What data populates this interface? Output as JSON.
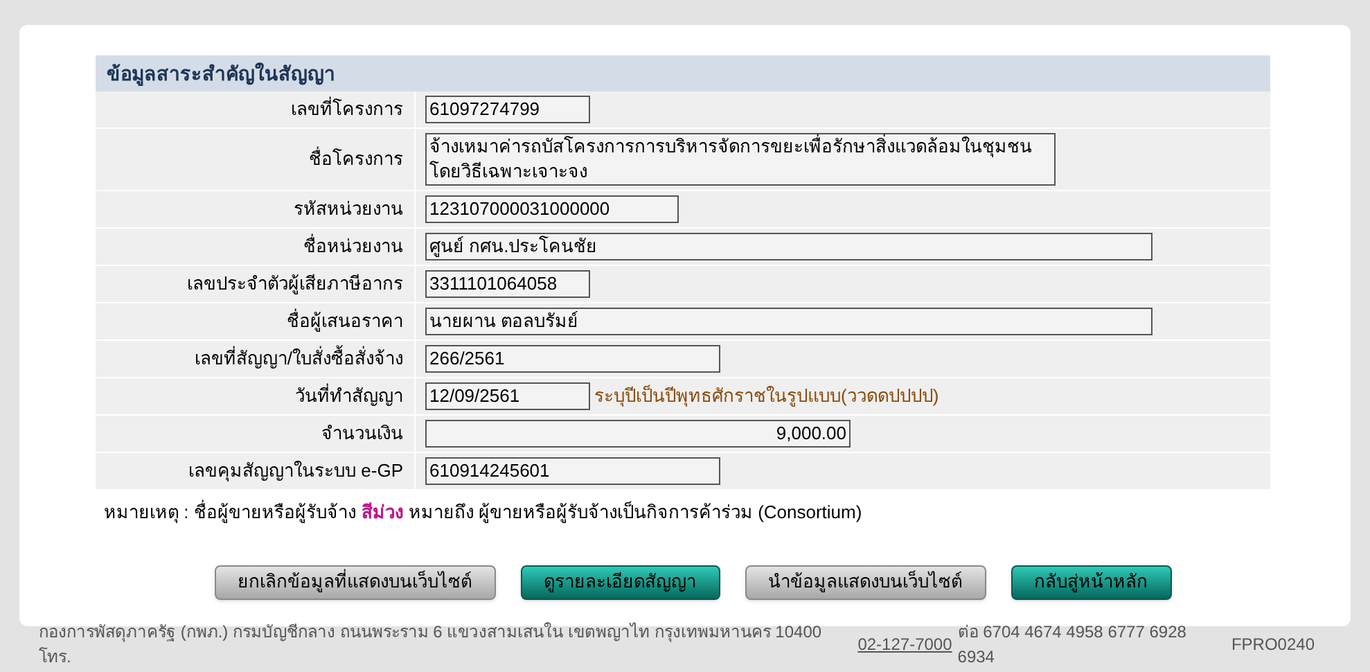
{
  "section_title": "ข้อมูลสาระสำคัญในสัญญา",
  "rows": [
    {
      "label": "เลขที่โครงการ",
      "value": "61097274799"
    },
    {
      "label": "ชื่อโครงการ",
      "value": "จ้างเหมาค่ารถบัสโครงการการบริหารจัดการขยะเพื่อรักษาสิ่งแวดล้อมในชุมชน\nโดยวิธีเฉพาะเจาะจง"
    },
    {
      "label": "รหัสหน่วยงาน",
      "value": "123107000031000000"
    },
    {
      "label": "ชื่อหน่วยงาน",
      "value": "ศูนย์ กศน.ประโคนชัย"
    },
    {
      "label": "เลขประจำตัวผู้เสียภาษีอากร",
      "value": "3311101064058"
    },
    {
      "label": "ชื่อผู้เสนอราคา",
      "value": "นายผาน  ตอลบรัมย์"
    },
    {
      "label": "เลขที่สัญญา/ใบสั่งซื้อสั่งจ้าง",
      "value": "266/2561"
    },
    {
      "label": "วันที่ทำสัญญา",
      "value": "12/09/2561",
      "hint": "ระบุปีเป็นปีพุทธศักราชในรูปแบบ(ววดดปปปป)"
    },
    {
      "label": "จำนวนเงิน",
      "value": "9,000.00"
    },
    {
      "label": "เลขคุมสัญญาในระบบ e-GP",
      "value": "610914245601"
    }
  ],
  "note": {
    "prefix": "หมายเหตุ : ชื่อผู้ขายหรือผู้รับจ้าง",
    "highlight": "สีม่วง",
    "suffix": "หมายถึง ผู้ขายหรือผู้รับจ้างเป็นกิจการค้าร่วม (Consortium)"
  },
  "buttons": [
    {
      "label": "ยกเลิกข้อมูลที่แสดงบนเว็บไซต์",
      "kind": "secondary"
    },
    {
      "label": "ดูรายละเอียดสัญญา",
      "kind": "primary"
    },
    {
      "label": "นำข้อมูลแสดงบนเว็บไซต์",
      "kind": "secondary"
    },
    {
      "label": "กลับสู่หน้าหลัก",
      "kind": "primary"
    }
  ],
  "footer": {
    "address": "กองการพัสดุภาครัฐ (กพภ.) กรมบัญชีกลาง ถนนพระราม 6 แขวงสามเสนใน เขตพญาไท กรุงเทพมหานคร 10400 โทร.",
    "phone": "02-127-7000",
    "extensions": "ต่อ 6704 4674 4958 6777 6928 6934",
    "code": "FPRO0240"
  }
}
